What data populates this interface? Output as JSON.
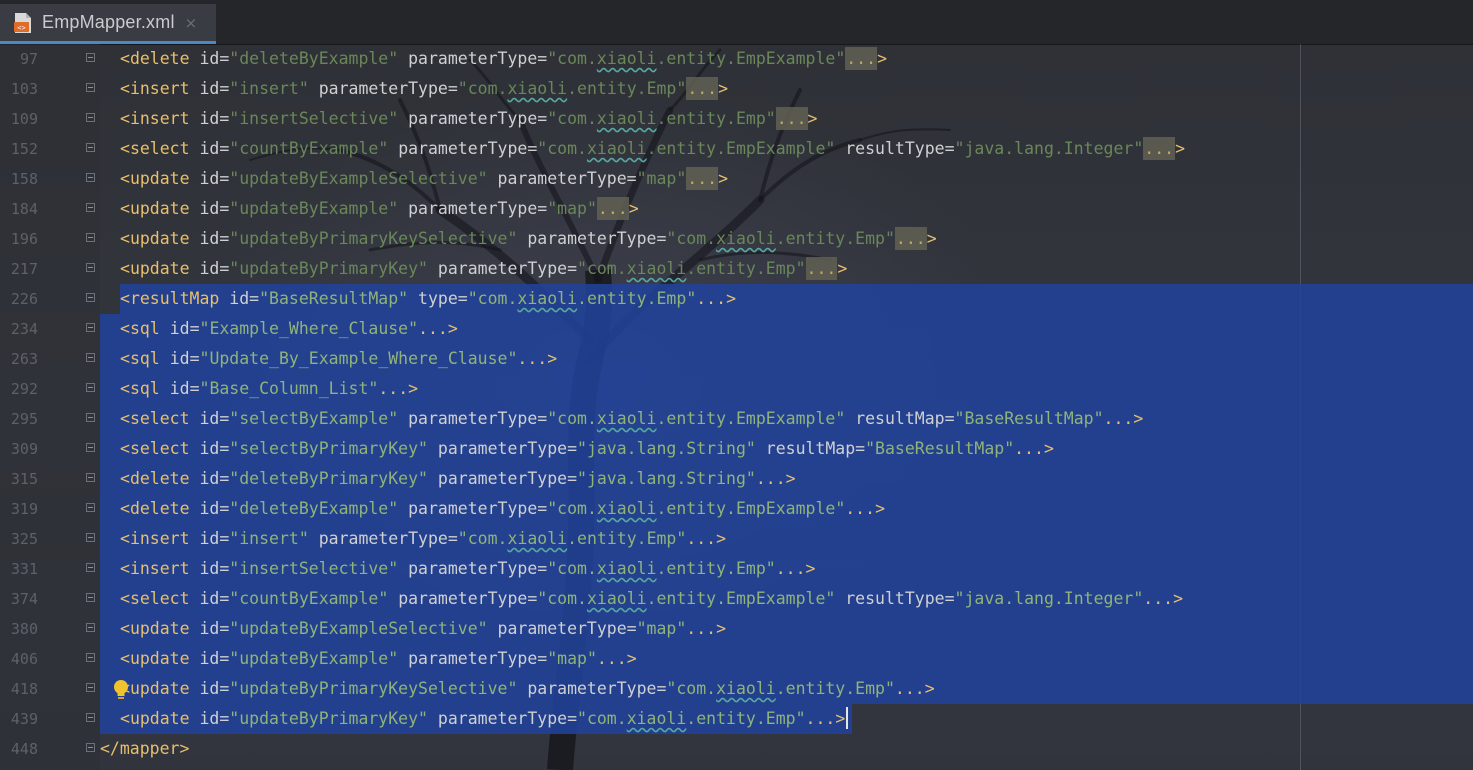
{
  "tab": {
    "filename": "EmpMapper.xml",
    "close": "×"
  },
  "lines": [
    {
      "num": "97",
      "tag": "delete",
      "id": "deleteByExample",
      "parameterType": "com.xiaoli.entity.EmpExample",
      "resultLabel": "",
      "resultValue": "",
      "folded": true,
      "selected": false
    },
    {
      "num": "103",
      "tag": "insert",
      "id": "insert",
      "parameterType": "com.xiaoli.entity.Emp",
      "resultLabel": "",
      "resultValue": "",
      "folded": true,
      "selected": false
    },
    {
      "num": "109",
      "tag": "insert",
      "id": "insertSelective",
      "parameterType": "com.xiaoli.entity.Emp",
      "resultLabel": "",
      "resultValue": "",
      "folded": true,
      "selected": false
    },
    {
      "num": "152",
      "tag": "select",
      "id": "countByExample",
      "parameterType": "com.xiaoli.entity.EmpExample",
      "resultLabel": "resultType",
      "resultValue": "java.lang.Integer",
      "folded": true,
      "selected": false
    },
    {
      "num": "158",
      "tag": "update",
      "id": "updateByExampleSelective",
      "parameterType": "map",
      "resultLabel": "",
      "resultValue": "",
      "folded": true,
      "selected": false
    },
    {
      "num": "184",
      "tag": "update",
      "id": "updateByExample",
      "parameterType": "map",
      "resultLabel": "",
      "resultValue": "",
      "folded": true,
      "selected": false
    },
    {
      "num": "196",
      "tag": "update",
      "id": "updateByPrimaryKeySelective",
      "parameterType": "com.xiaoli.entity.Emp",
      "resultLabel": "",
      "resultValue": "",
      "folded": true,
      "selected": false
    },
    {
      "num": "217",
      "tag": "update",
      "id": "updateByPrimaryKey",
      "parameterType": "com.xiaoli.entity.Emp",
      "resultLabel": "",
      "resultValue": "",
      "folded": true,
      "selected": false
    },
    {
      "num": "226",
      "tag": "resultMap",
      "id": "BaseResultMap",
      "paramLabel": "type",
      "parameterType": "com.xiaoli.entity.Emp",
      "resultLabel": "",
      "resultValue": "",
      "folded": true,
      "selected": true
    },
    {
      "num": "234",
      "tag": "sql",
      "id": "Example_Where_Clause",
      "parameterType": "",
      "resultLabel": "",
      "resultValue": "",
      "folded": true,
      "selected": true
    },
    {
      "num": "263",
      "tag": "sql",
      "id": "Update_By_Example_Where_Clause",
      "parameterType": "",
      "resultLabel": "",
      "resultValue": "",
      "folded": true,
      "selected": true
    },
    {
      "num": "292",
      "tag": "sql",
      "id": "Base_Column_List",
      "parameterType": "",
      "resultLabel": "",
      "resultValue": "",
      "folded": true,
      "selected": true
    },
    {
      "num": "295",
      "tag": "select",
      "id": "selectByExample",
      "parameterType": "com.xiaoli.entity.EmpExample",
      "resultLabel": "resultMap",
      "resultValue": "BaseResultMap",
      "folded": true,
      "selected": true
    },
    {
      "num": "309",
      "tag": "select",
      "id": "selectByPrimaryKey",
      "parameterType": "java.lang.String",
      "resultLabel": "resultMap",
      "resultValue": "BaseResultMap",
      "folded": true,
      "selected": true
    },
    {
      "num": "315",
      "tag": "delete",
      "id": "deleteByPrimaryKey",
      "parameterType": "java.lang.String",
      "resultLabel": "",
      "resultValue": "",
      "folded": true,
      "selected": true
    },
    {
      "num": "319",
      "tag": "delete",
      "id": "deleteByExample",
      "parameterType": "com.xiaoli.entity.EmpExample",
      "resultLabel": "",
      "resultValue": "",
      "folded": true,
      "selected": true
    },
    {
      "num": "325",
      "tag": "insert",
      "id": "insert",
      "parameterType": "com.xiaoli.entity.Emp",
      "resultLabel": "",
      "resultValue": "",
      "folded": true,
      "selected": true
    },
    {
      "num": "331",
      "tag": "insert",
      "id": "insertSelective",
      "parameterType": "com.xiaoli.entity.Emp",
      "resultLabel": "",
      "resultValue": "",
      "folded": true,
      "selected": true
    },
    {
      "num": "374",
      "tag": "select",
      "id": "countByExample",
      "parameterType": "com.xiaoli.entity.EmpExample",
      "resultLabel": "resultType",
      "resultValue": "java.lang.Integer",
      "folded": true,
      "selected": true
    },
    {
      "num": "380",
      "tag": "update",
      "id": "updateByExampleSelective",
      "parameterType": "map",
      "resultLabel": "",
      "resultValue": "",
      "folded": true,
      "selected": true
    },
    {
      "num": "406",
      "tag": "update",
      "id": "updateByExample",
      "parameterType": "map",
      "resultLabel": "",
      "resultValue": "",
      "folded": true,
      "selected": true
    },
    {
      "num": "418",
      "tag": "update",
      "id": "updateByPrimaryKeySelective",
      "parameterType": "com.xiaoli.entity.Emp",
      "resultLabel": "",
      "resultValue": "",
      "folded": true,
      "selected": true,
      "bulb": true
    },
    {
      "num": "439",
      "tag": "update",
      "id": "updateByPrimaryKey",
      "parameterType": "com.xiaoli.entity.Emp",
      "resultLabel": "",
      "resultValue": "",
      "folded": true,
      "selected": true,
      "caret": true
    },
    {
      "num": "448",
      "closing": "</mapper>",
      "folded": false,
      "selected": false
    }
  ],
  "fold_placeholder": "...",
  "colors": {
    "tag": "#e8bf6a",
    "attribute": "#cfd0d2",
    "value": "#6a8759",
    "selection": "#21429c",
    "tab_underline": "#4a88c7"
  },
  "icons": {
    "tab": "xml-file-icon",
    "intention": "lightbulb-icon",
    "fold": "fold-marker-icon"
  }
}
